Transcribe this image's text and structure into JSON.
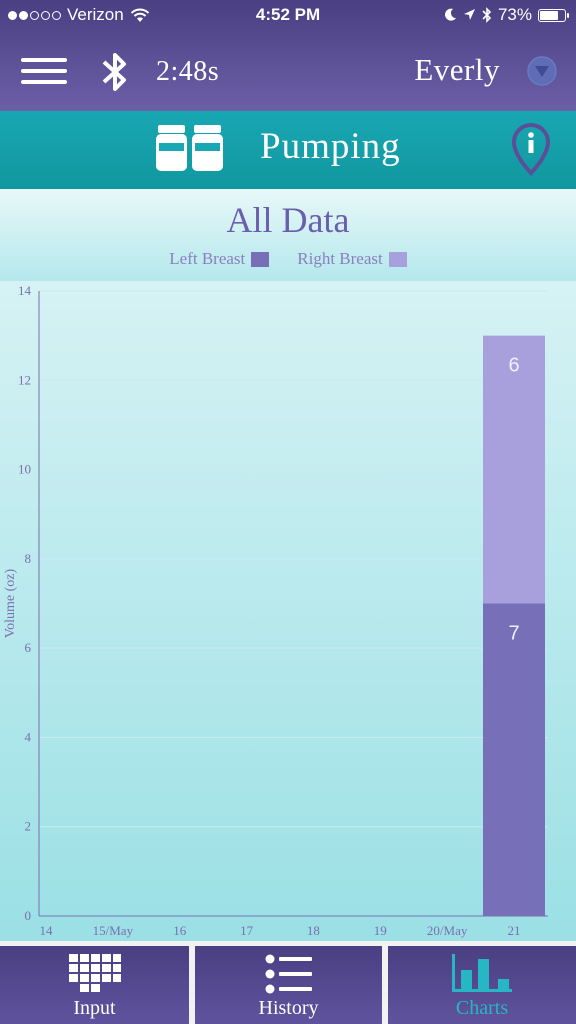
{
  "status_bar": {
    "carrier": "Verizon",
    "time": "4:52 PM",
    "battery": "73%",
    "signal_bars": 2,
    "battery_level": 0.73
  },
  "nav": {
    "timer": "2:48s",
    "user_name": "Everly"
  },
  "mode": {
    "title": "Pumping"
  },
  "chart_header": {
    "title": "All Data",
    "legend": [
      {
        "label": "Left Breast",
        "color": "#7770b8"
      },
      {
        "label": "Right Breast",
        "color": "#a8a0dc"
      }
    ]
  },
  "chart_data": {
    "type": "bar",
    "stacked": true,
    "ylabel": "Volume (oz)",
    "ylim": [
      0,
      14
    ],
    "yticks": [
      0,
      2,
      4,
      6,
      8,
      10,
      12,
      14
    ],
    "x_tick_labels": [
      "14",
      "15/May",
      "16",
      "17",
      "18",
      "19",
      "20/May",
      "21"
    ],
    "categories": [
      "21"
    ],
    "series": [
      {
        "name": "Left Breast",
        "values": [
          7
        ],
        "color": "#7770b8"
      },
      {
        "name": "Right Breast",
        "values": [
          6
        ],
        "color": "#a8a0dc"
      }
    ],
    "grid": true
  },
  "tabs": [
    {
      "label": "Input",
      "icon": "keypad-grid-icon",
      "active": false
    },
    {
      "label": "History",
      "icon": "list-icon",
      "active": false
    },
    {
      "label": "Charts",
      "icon": "bar-chart-icon",
      "active": true
    }
  ]
}
